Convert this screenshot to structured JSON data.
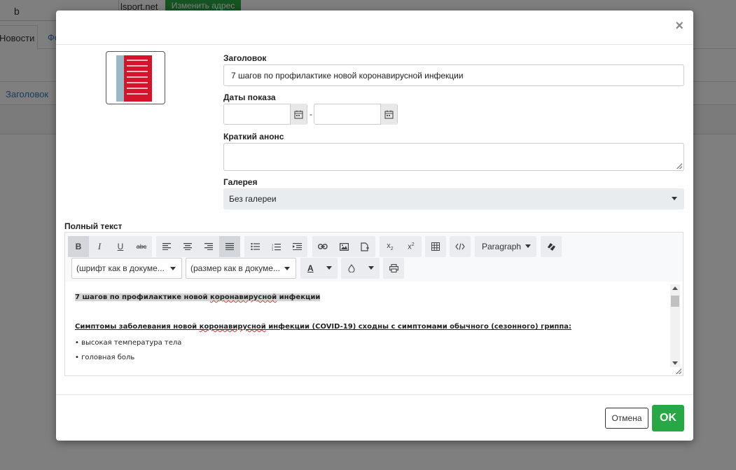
{
  "background": {
    "protocol": "://",
    "url_value": "b",
    "domain_suffix": "lsport.net",
    "change_address_button": "Изменить адрес",
    "tabs": [
      {
        "label": "Новости"
      },
      {
        "label": "Фо"
      }
    ],
    "table_header": "Заголовок"
  },
  "modal": {
    "close": "×",
    "title_label": "Заголовок",
    "title_value": "7 шагов по профилактике новой коронавирусной инфекции",
    "dates_label": "Даты показа",
    "dates_separator": "-",
    "announce_label": "Краткий анонс",
    "gallery_label": "Галерея",
    "gallery_value": "Без галереи",
    "full_text_label": "Полный текст",
    "cancel_button": "Отмена",
    "ok_button": "OK"
  },
  "editor": {
    "toolbar": {
      "paragraph": "Paragraph",
      "font_family": "(шрифт как в докуме...",
      "font_size": "(размер как в докуме...",
      "font_color_glyph": "A"
    },
    "content": {
      "line1": "7 шагов по профилактике новой ",
      "line1_spell": "коронавирусной",
      "line1_end": " инфекции",
      "line2": "Симптомы заболевания новой ",
      "line2_spell": "коронавирусной",
      "line2_end": " инфекции (COVID-19) сходны с симптомами обычного (сезонного) гриппа:",
      "bullet1": "• высокая температура тела",
      "bullet2": "• головная боль"
    }
  },
  "colors": {
    "accent_green": "#28a745",
    "link_blue": "#337ab7"
  }
}
